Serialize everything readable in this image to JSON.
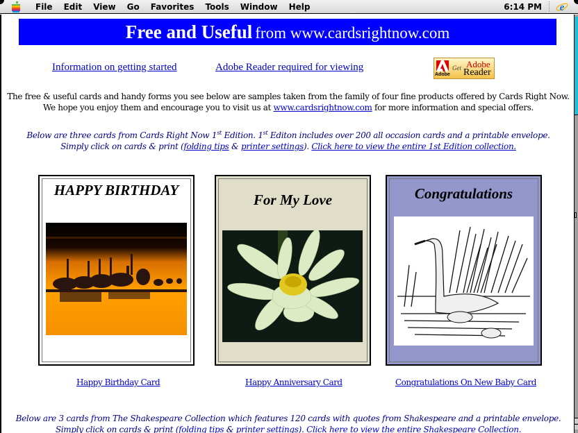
{
  "menubar": {
    "apple_icon": "apple-logo-icon",
    "items": [
      "File",
      "Edit",
      "View",
      "Go",
      "Favorites",
      "Tools",
      "Window",
      "Help"
    ],
    "clock": "6:14 PM",
    "app_icon": "internet-explorer-icon"
  },
  "banner": {
    "title_bold": "Free and Useful",
    "title_rest": "from www.cardsrightnow.com",
    "background": "#0000ff"
  },
  "top_links": {
    "info": "Information on getting started",
    "adobe": "Adobe Reader required for viewing",
    "badge": {
      "adobe": "Adobe",
      "get": "Get",
      "adobe_red": "Adobe",
      "reader": "Reader"
    }
  },
  "intro": {
    "line1": "The free & useful cards and handy forms you see below are samples taken from the family of four fine products offered by Cards Right Now.",
    "line2_pre": "We hope you enjoy them and encourage you to visit us at ",
    "line2_link": "www.cardsrightnow.com",
    "line2_post": " for more information and special offers."
  },
  "edition_section": {
    "line1_a": "Below are three cards from Cards Right Now 1",
    "sup1": "st",
    "line1_b": " Edition. 1",
    "sup2": "st",
    "line1_c": " Editon includes over 200 all occasion cards and a printable envelope.",
    "line2_pre": "Simply click on cards & print (",
    "folding_tips": "folding tips",
    "amp": " & ",
    "printer_settings": "printer settings",
    "line2_mid": "). ",
    "view_all": "Click here to view the entire 1st Edition collection."
  },
  "cards": [
    {
      "title": "HAPPY BIRTHDAY",
      "caption": "Happy Birthday Card",
      "background": "#ffffff",
      "image": "pelicans-at-sunset"
    },
    {
      "title": "For My Love",
      "caption": "Happy Anniversary Card",
      "background": "#e0dec8",
      "image": "white-lotus-flower"
    },
    {
      "title": "Congratulations",
      "caption": "Congratulations On New Baby Card",
      "background": "#9497cc",
      "image": "swan-with-cygnets-sketch"
    }
  ],
  "shakespeare_section": {
    "line1": "Below are 3 cards from The Shakespeare Collection which features 120 cards with quotes from Shakespeare and a printable envelope.",
    "line2_pre": "Simply click on cards & print (",
    "folding_tips": "folding tips",
    "amp": " & ",
    "printer_settings": "printer settings",
    "line2_mid": "). ",
    "view_all": "Click here to view the entire Shakespeare Collection."
  }
}
